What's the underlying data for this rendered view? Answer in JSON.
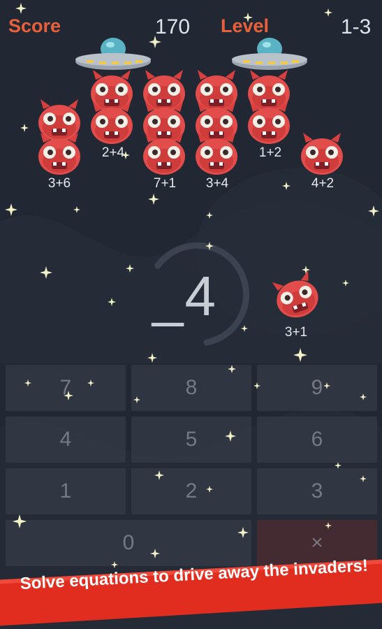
{
  "hud": {
    "score_label": "Score",
    "score_value": "170",
    "level_label": "Level",
    "level_value": "1-3"
  },
  "equations": {
    "col1": "3+6",
    "col2": "2+4",
    "col3": "7+1",
    "col4": "3+4",
    "col5": "1+2",
    "col6": "4+2",
    "attacker": "3+1"
  },
  "answer": {
    "text": "_4"
  },
  "keypad": {
    "keys": [
      "7",
      "8",
      "9",
      "4",
      "5",
      "6",
      "1",
      "2",
      "3",
      "0",
      "×"
    ]
  },
  "banner": {
    "text": "Solve equations to drive away the invaders!"
  },
  "colors": {
    "background": "#222833",
    "accent_orange": "#e8603a",
    "monster_red": "#e24c4b",
    "banner_red": "#e02d1f"
  }
}
